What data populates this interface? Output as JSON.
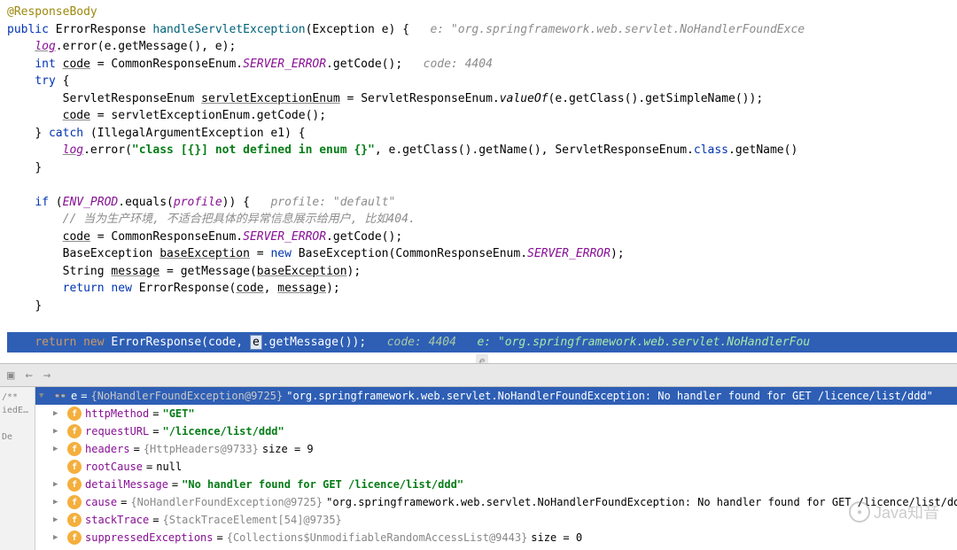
{
  "code": {
    "l1": "@ResponseBody",
    "l2_public": "public",
    "l2_type": "ErrorResponse",
    "l2_method": "handleServletException",
    "l2_params": "(Exception e) {",
    "l2_hint": "e: \"org.springframework.web.servlet.NoHandlerFoundExce",
    "l3_log": "log",
    "l3_rest": ".error(e.getMessage(), e);",
    "l4_int": "int",
    "l4_code": "code",
    "l4_assign": " = CommonResponseEnum.",
    "l4_enum": "SERVER_ERROR",
    "l4_call": ".getCode();",
    "l4_hint": "code: 4404",
    "l5_try": "try",
    "l5_brace": " {",
    "l6_type": "ServletResponseEnum ",
    "l6_var": "servletExceptionEnum",
    "l6_assign": " = ServletResponseEnum.",
    "l6_method": "valueOf",
    "l6_rest": "(e.getClass().getSimpleName());",
    "l7_var": "code",
    "l7_rest": " = servletExceptionEnum.getCode();",
    "l8_close": "} ",
    "l8_catch": "catch",
    "l8_rest": " (IllegalArgumentException e1) {",
    "l9_log": "log",
    "l9_error": ".error(",
    "l9_str": "\"class [{}] not defined in enum {}\"",
    "l9_rest": ", e.getClass().getName(), ServletResponseEnum.",
    "l9_class": "class",
    "l9_tail": ".getName()",
    "l10": "}",
    "l12_if": "if",
    "l12_open": " (",
    "l12_env": "ENV_PROD",
    "l12_equals": ".equals(",
    "l12_profile": "profile",
    "l12_close": ")) {",
    "l12_hint": "profile: \"default\"",
    "l13_comment": "// 当为生产环境, 不适合把具体的异常信息展示给用户, 比如404.",
    "l14_var": "code",
    "l14_mid": " = CommonResponseEnum.",
    "l14_enum": "SERVER_ERROR",
    "l14_rest": ".getCode();",
    "l15_pre": "BaseException ",
    "l15_var": "baseException",
    "l15_eq": " = ",
    "l15_new": "new",
    "l15_mid": " BaseException(CommonResponseEnum.",
    "l15_enum": "SERVER_ERROR",
    "l15_close": ");",
    "l16_pre": "String ",
    "l16_var": "message",
    "l16_rest": " = getMessage(",
    "l16_arg": "baseException",
    "l16_close": ");",
    "l17_return": "return",
    "l17_sp": " ",
    "l17_new": "new",
    "l17_rest": " ErrorResponse(",
    "l17_code": "code",
    "l17_comma": ", ",
    "l17_msg": "message",
    "l17_close": ");",
    "l18": "}",
    "hl_return": "return",
    "hl_new": "new",
    "hl_text": " ErrorResponse(code, ",
    "hl_e": "e",
    "hl_tail": ".getMessage());",
    "hl_hint1": "code: 4404",
    "hl_hint2": "e: \"org.springframework.web.servlet.NoHandlerFou",
    "hint_e": "e",
    "l_close": "}"
  },
  "debugger": {
    "root_var": "e",
    "root_type": "{NoHandlerFoundException@9725}",
    "root_value": "\"org.springframework.web.servlet.NoHandlerFoundException: No handler found for GET /licence/list/ddd\"",
    "vars": [
      {
        "name": "httpMethod",
        "value": "\"GET\"",
        "type": "string"
      },
      {
        "name": "requestURL",
        "value": "\"/licence/list/ddd\"",
        "type": "string"
      },
      {
        "name": "headers",
        "value": "{HttpHeaders@9733}",
        "size": "size = 9",
        "type": "object"
      },
      {
        "name": "rootCause",
        "value": "null",
        "type": "null"
      },
      {
        "name": "detailMessage",
        "value": "\"No handler found for GET /licence/list/ddd\"",
        "type": "string"
      },
      {
        "name": "cause",
        "value": "{NoHandlerFoundException@9725}",
        "tail": "\"org.springframework.web.servlet.NoHandlerFoundException: No handler found for GET /licence/list/ddd\"",
        "type": "object"
      },
      {
        "name": "stackTrace",
        "value": "{StackTraceElement[54]@9735}",
        "type": "object"
      },
      {
        "name": "suppressedExceptions",
        "value": "{Collections$UnmodifiableRandomAccessList@9443}",
        "size": "size = 0",
        "type": "object"
      }
    ]
  },
  "gutter": {
    "item1": "/**",
    "item2": "iedExc",
    "item3": "De"
  },
  "watermark": "Java知音"
}
